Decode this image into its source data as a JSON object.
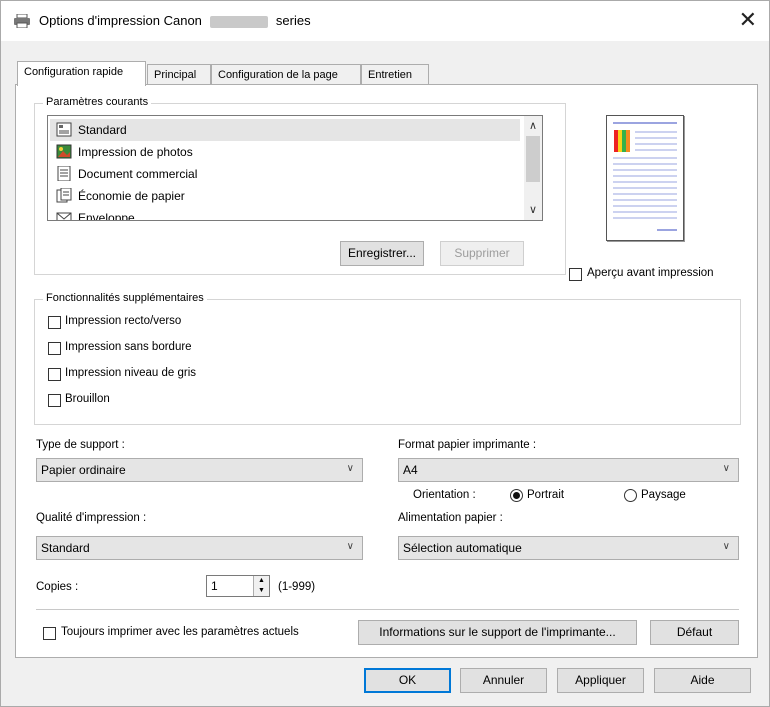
{
  "window": {
    "title_prefix": "Options d'impression Canon",
    "title_suffix": "series",
    "close": "✕"
  },
  "tabs": [
    {
      "label": "Configuration rapide",
      "active": true
    },
    {
      "label": "Principal",
      "active": false
    },
    {
      "label": "Configuration de la page",
      "active": false
    },
    {
      "label": "Entretien",
      "active": false
    }
  ],
  "current_settings": {
    "group_label": "Paramètres courants",
    "items": [
      {
        "label": "Standard",
        "icon": "standard-icon",
        "selected": true
      },
      {
        "label": "Impression de photos",
        "icon": "photo-icon",
        "selected": false
      },
      {
        "label": "Document commercial",
        "icon": "document-icon",
        "selected": false
      },
      {
        "label": "Économie de papier",
        "icon": "paper-saving-icon",
        "selected": false
      },
      {
        "label": "Enveloppe",
        "icon": "envelope-icon",
        "selected": false
      }
    ],
    "save_button": "Enregistrer...",
    "delete_button": "Supprimer"
  },
  "preview": {
    "checkbox_label": "Aperçu avant impression",
    "checked": false
  },
  "features": {
    "group_label": "Fonctionnalités supplémentaires",
    "items": [
      {
        "label": "Impression recto/verso",
        "checked": false
      },
      {
        "label": "Impression sans bordure",
        "checked": false
      },
      {
        "label": "Impression niveau de gris",
        "checked": false
      },
      {
        "label": "Brouillon",
        "checked": false
      }
    ]
  },
  "media_type": {
    "label": "Type de support :",
    "value": "Papier ordinaire"
  },
  "page_size": {
    "label": "Format papier imprimante :",
    "value": "A4"
  },
  "orientation": {
    "label": "Orientation :",
    "portrait": "Portrait",
    "landscape": "Paysage",
    "selected": "portrait"
  },
  "print_quality": {
    "label": "Qualité d'impression :",
    "value": "Standard"
  },
  "paper_source": {
    "label": "Alimentation papier :",
    "value": "Sélection automatique"
  },
  "copies": {
    "label": "Copies :",
    "value": "1",
    "range": "(1-999)"
  },
  "always_print": {
    "label": "Toujours imprimer avec les paramètres actuels",
    "checked": false
  },
  "media_info_button": "Informations sur le support de l'imprimante...",
  "default_button": "Défaut",
  "footer": {
    "ok": "OK",
    "cancel": "Annuler",
    "apply": "Appliquer",
    "help": "Aide"
  }
}
